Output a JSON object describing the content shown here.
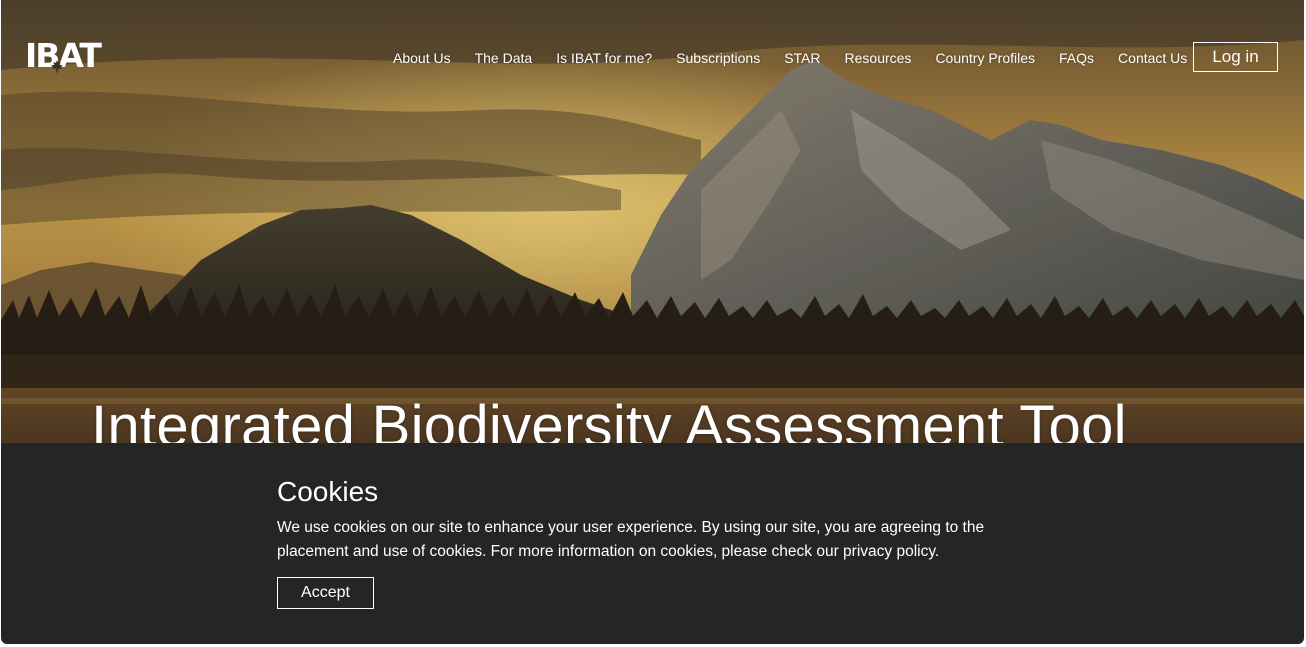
{
  "brand": {
    "logo_text": "IBAT"
  },
  "nav": {
    "items": [
      {
        "label": "About Us"
      },
      {
        "label": "The Data"
      },
      {
        "label": "Is IBAT for me?"
      },
      {
        "label": "Subscriptions"
      },
      {
        "label": "STAR"
      },
      {
        "label": "Resources"
      },
      {
        "label": "Country Profiles"
      },
      {
        "label": "FAQs"
      },
      {
        "label": "Contact Us"
      }
    ],
    "login_label": "Log in"
  },
  "hero": {
    "title": "Integrated Biodiversity Assessment Tool"
  },
  "cookies": {
    "heading": "Cookies",
    "body": "We use cookies on our site to enhance your user experience. By using our site, you are agreeing to the placement and use of cookies. For more information on cookies, please check our privacy policy.",
    "accept_label": "Accept"
  },
  "colors": {
    "banner_bg": "#252525",
    "text": "#ffffff"
  },
  "icons": {
    "logo_mark": "maple-leaf-icon"
  }
}
